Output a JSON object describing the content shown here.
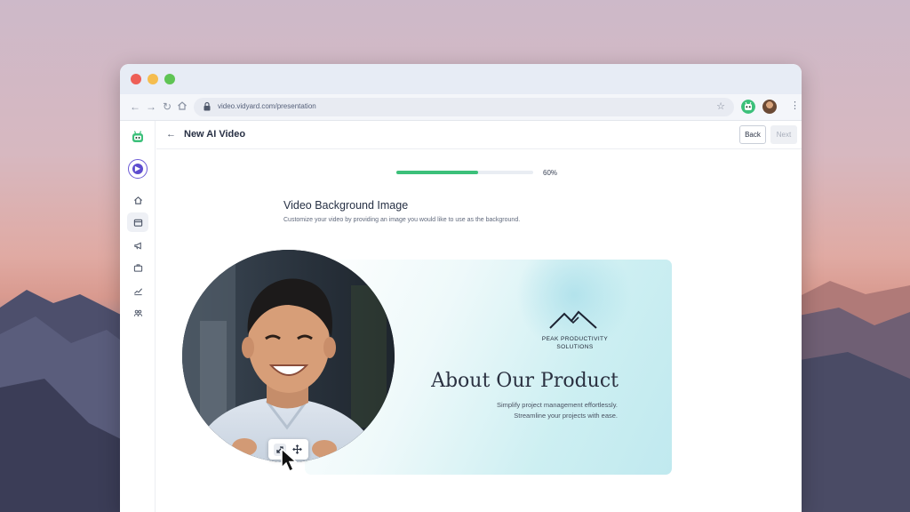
{
  "browser": {
    "url": "video.vidyard.com/presentation"
  },
  "header": {
    "title": "New AI Video",
    "back_label": "Back",
    "next_label": "Next"
  },
  "progress": {
    "value": 60,
    "label": "60%"
  },
  "section": {
    "title": "Video Background Image",
    "description": "Customize your video by providing an image you would like to use as the background."
  },
  "slide": {
    "logo_text_line1": "PEAK PRODUCTIVITY",
    "logo_text_line2": "SOLUTIONS",
    "heading": "About Our Product",
    "sub_line1": "Simplify project management effortlessly.",
    "sub_line2": "Streamline your projects with ease."
  },
  "sidebar": {
    "items": [
      "home-icon",
      "video-library-icon",
      "megaphone-icon",
      "briefcase-icon",
      "analytics-icon",
      "team-icon"
    ],
    "active_index": 1
  },
  "colors": {
    "progress": "#3cc07a",
    "accent": "#5d4ccf"
  }
}
